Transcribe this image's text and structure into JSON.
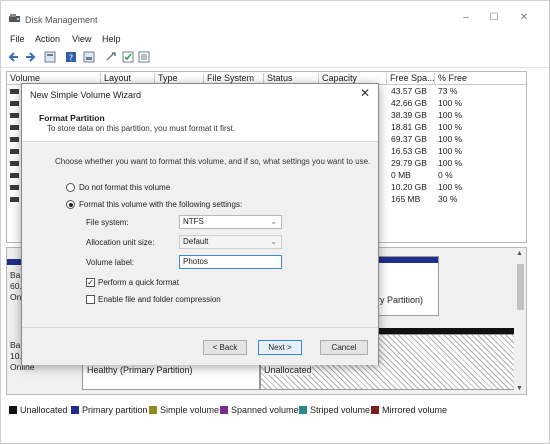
{
  "window": {
    "title": "Disk Management",
    "minimize": "–",
    "maximize": "☐",
    "close": "✕"
  },
  "menu": [
    "File",
    "Action",
    "View",
    "Help"
  ],
  "toolbar_icons": [
    "back-icon",
    "forward-icon",
    "properties-icon",
    "help-icon",
    "refresh-icon",
    "settings-icon",
    "checklist-icon",
    "list-icon"
  ],
  "volume_table": {
    "columns": [
      "Volume",
      "Layout",
      "Type",
      "File System",
      "Status",
      "Capacity",
      "Free Spa...",
      "% Free"
    ],
    "free_space": [
      "43.57 GB",
      "42.66 GB",
      "38.39 GB",
      "18.81 GB",
      "69.37 GB",
      "16.53 GB",
      "29.79 GB",
      "0 MB",
      "10.20 GB",
      "165 MB"
    ],
    "percent_free": [
      "73 %",
      "100 %",
      "100 %",
      "100 %",
      "100 %",
      "100 %",
      "100 %",
      "0 %",
      "100 %",
      "30 %"
    ]
  },
  "disks": [
    {
      "label_lines": [
        "Ba",
        "60.",
        "On"
      ],
      "partition_text": "ry Partition)"
    },
    {
      "label_lines": [
        "Ba",
        "10.",
        "Online"
      ],
      "healthy_text": "Healthy (Primary Partition)",
      "unallocated_text": "Unallocated"
    }
  ],
  "legend": [
    {
      "label": "Unallocated",
      "color": "#111111"
    },
    {
      "label": "Primary partition",
      "color": "#1f2e8c"
    },
    {
      "label": "Simple volume",
      "color": "#8b8b1e"
    },
    {
      "label": "Spanned volume",
      "color": "#7a2a8a"
    },
    {
      "label": "Striped volume",
      "color": "#2a8a8a"
    },
    {
      "label": "Mirrored volume",
      "color": "#7a1e1e"
    }
  ],
  "dialog": {
    "title": "New Simple Volume Wizard",
    "close": "✕",
    "heading": "Format Partition",
    "subheading": "To store data on this partition, you must format it first.",
    "instruction": "Choose whether you want to format this volume, and if so, what settings you want to use.",
    "option_no_format": "Do not format this volume",
    "option_format": "Format this volume with the following settings:",
    "file_system_label": "File system:",
    "file_system_value": "NTFS",
    "allocation_label": "Allocation unit size:",
    "allocation_value": "Default",
    "volume_label_label": "Volume label:",
    "volume_label_value": "Photos",
    "quick_format_label": "Perform a quick format",
    "quick_format_checked": true,
    "compression_label": "Enable file and folder compression",
    "compression_checked": false,
    "back_button": "< Back",
    "next_button": "Next >",
    "cancel_button": "Cancel"
  }
}
